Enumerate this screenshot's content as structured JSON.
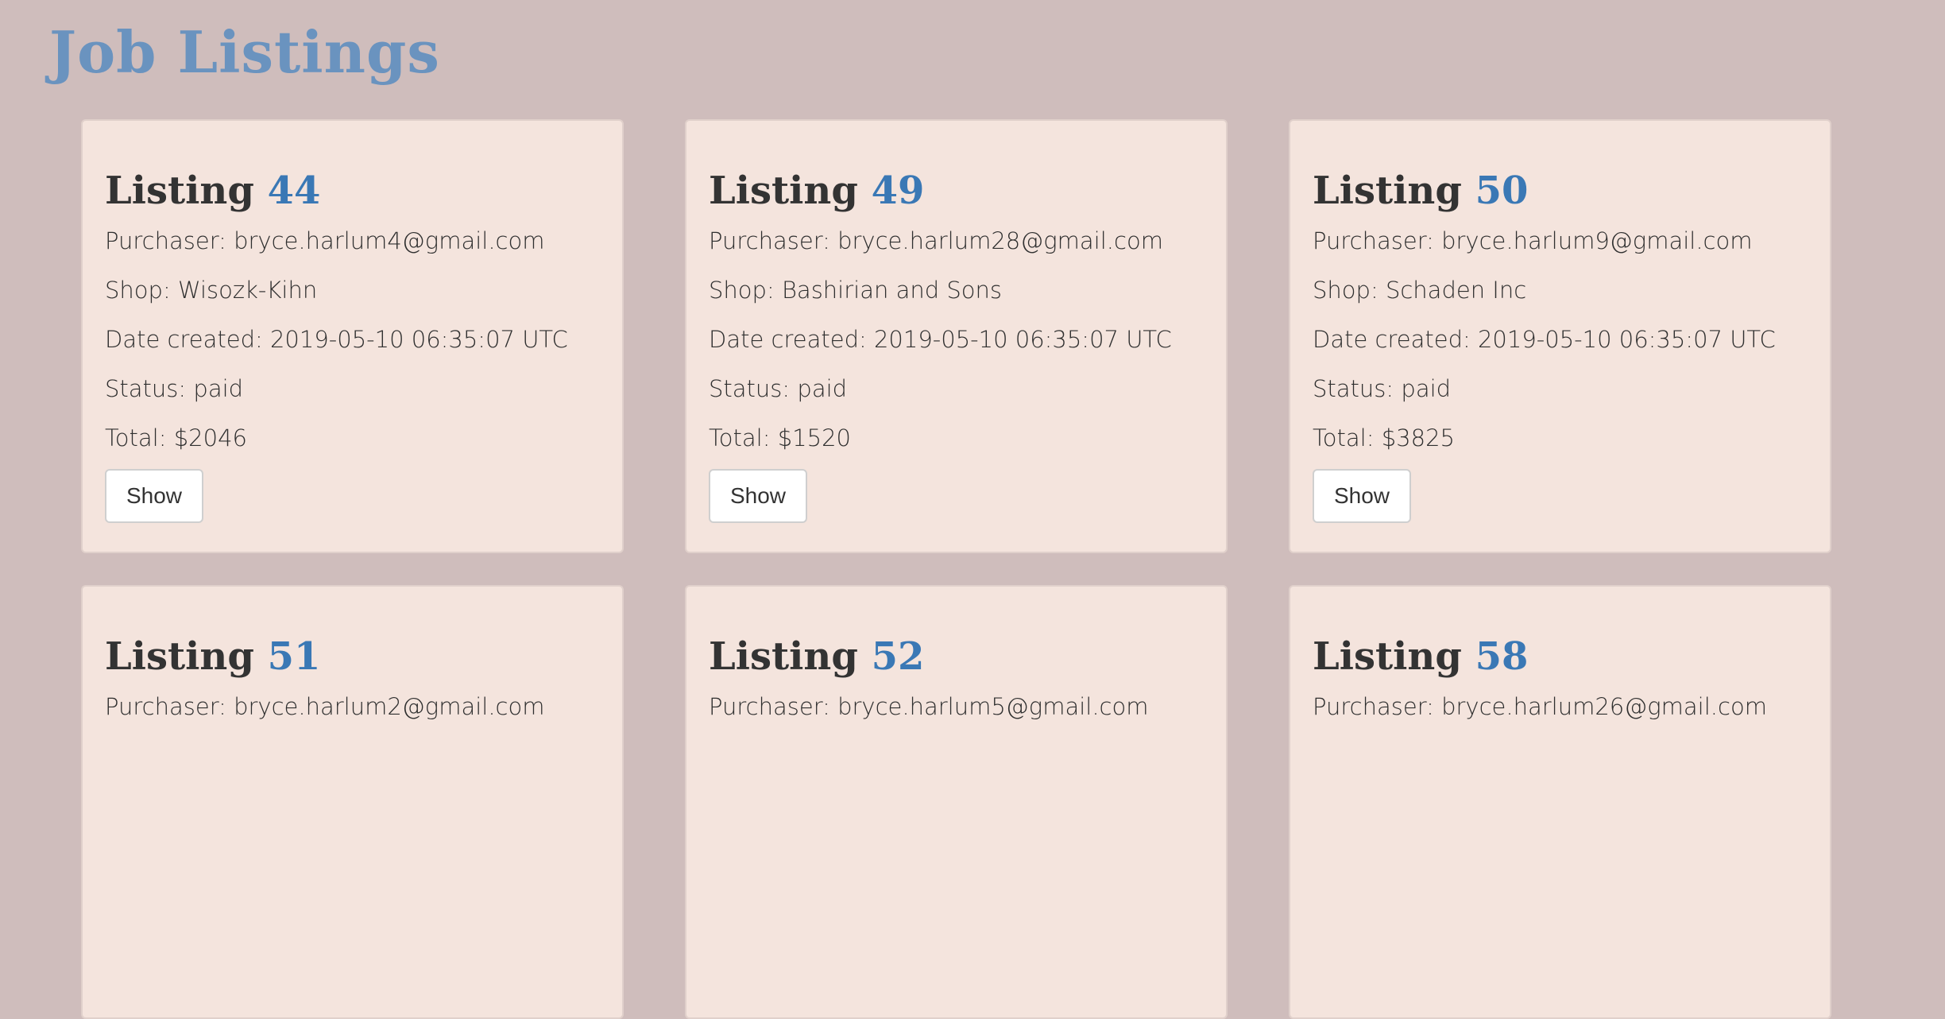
{
  "page": {
    "title": "Job Listings"
  },
  "labels": {
    "listing_prefix": "Listing",
    "purchaser": "Purchaser: ",
    "shop": "Shop: ",
    "date_created": "Date created: ",
    "status": "Status: ",
    "total": "Total: ",
    "show_button": "Show"
  },
  "listings": [
    {
      "number": "44",
      "purchaser": "bryce.harlum4@gmail.com",
      "shop": "Wisozk-Kihn",
      "date_created": "2019-05-10 06:35:07 UTC",
      "status": "paid",
      "total": "$2046"
    },
    {
      "number": "49",
      "purchaser": "bryce.harlum28@gmail.com",
      "shop": "Bashirian and Sons",
      "date_created": "2019-05-10 06:35:07 UTC",
      "status": "paid",
      "total": "$1520"
    },
    {
      "number": "50",
      "purchaser": "bryce.harlum9@gmail.com",
      "shop": "Schaden Inc",
      "date_created": "2019-05-10 06:35:07 UTC",
      "status": "paid",
      "total": "$3825"
    },
    {
      "number": "51",
      "purchaser": "bryce.harlum2@gmail.com"
    },
    {
      "number": "52",
      "purchaser": "bryce.harlum5@gmail.com"
    },
    {
      "number": "58",
      "purchaser": "bryce.harlum26@gmail.com"
    }
  ],
  "colors": {
    "background": "#cfbdbc",
    "card": "#f4e4dd",
    "page_title": "#6a93bf",
    "listing_number": "#3a78b5"
  }
}
